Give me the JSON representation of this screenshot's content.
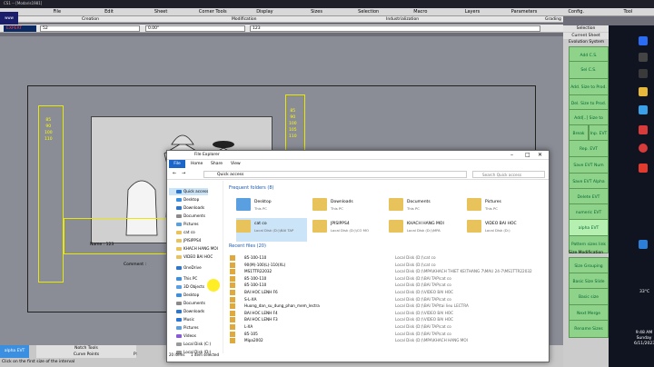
{
  "app": {
    "title": "CS1 -- [Modaris1981]",
    "logo": "www",
    "expert": "EXPERT"
  },
  "menu": [
    "File",
    "Edit",
    "Sheet",
    "Corner Tools",
    "Display",
    "Sizes",
    "Selection",
    "Macro",
    "Layers",
    "Parameters",
    "Config.",
    "Tool"
  ],
  "header": {
    "creation": "Creation",
    "modification": "Modification",
    "industrialization": "Industrialization",
    "grading": "Grading",
    "sel_label": "Selection",
    "current_sheet": "Current Sheet",
    "field1": "52",
    "field2": "0.00\"",
    "field3": "123"
  },
  "panel": {
    "items": [
      "Evolution System",
      "Add C.S.",
      "Sel C.S.",
      "Add. Size to Prod.",
      "Del. Size to Prod.",
      "Add[..] Size to Prod.",
      "Break",
      "Inp. EVT",
      "Rep. EVT",
      "Save EVT Num",
      "Save EVT Alpha",
      "Delete EVT",
      "numeric EVT",
      "alpha EVT",
      "Pattern sizes link",
      "Size Modification",
      "Size Grouping",
      "Basic Size Slide",
      "Basic size Modification",
      "Next Merge",
      "Rename Sizes"
    ]
  },
  "canvas": {
    "sizes_left": [
      "85",
      "90",
      "100",
      "110"
    ],
    "sizes_right": [
      "85",
      "90",
      "100",
      "105",
      "110"
    ],
    "name_label": "Name : 123",
    "comment": "Comment :",
    "aci": "ACI"
  },
  "status": {
    "alpha": "alpha EVT",
    "notch": "Notch Tools",
    "curve": "Curve Points",
    "hint": "Click on the first size of the interval",
    "p": "P:"
  },
  "explorer": {
    "title": "File Explorer",
    "tabs": [
      "File",
      "Home",
      "Share",
      "View"
    ],
    "path": "Quick access",
    "search": "Search Quick access",
    "nav": [
      "Quick access",
      "Desktop",
      "Downloads",
      "Documents",
      "Pictures",
      "cat co",
      "JPISIPPS4",
      "KHACH HANG MOI",
      "VIDEO BAI HOC",
      "OneDrive",
      "This PC",
      "3D Objects",
      "Desktop",
      "Documents",
      "Downloads",
      "Music",
      "Pictures",
      "Videos",
      "Local Disk (C:)",
      "Local Disk (D:)"
    ],
    "frequent_head": "Frequent folders (8)",
    "folders": [
      {
        "n": "Desktop",
        "s": "This PC"
      },
      {
        "n": "Downloads",
        "s": "This PC"
      },
      {
        "n": "Documents",
        "s": "This PC"
      },
      {
        "n": "Pictures",
        "s": "This PC"
      },
      {
        "n": "cat co",
        "s": "Local Disk (D:)\\BAI TAP"
      },
      {
        "n": "JPISIPPS4",
        "s": "Local Disk (D:)\\CO MO"
      },
      {
        "n": "KHACH HANG MOI",
        "s": "Local Disk (D:)\\MPA"
      },
      {
        "n": "VIDEO BAI HOC",
        "s": "Local Disk (D:)"
      }
    ],
    "recent_head": "Recent files (20)",
    "recent": [
      {
        "n": "85-100-110",
        "p": "Local Disk (D:)\\cat co"
      },
      {
        "n": "90(M)-100(L)-110(XL)",
        "p": "Local Disk (D:)\\cat co"
      },
      {
        "n": "MS1TTR22032",
        "p": "Local Disk (D:)\\MPA\\KHACH THIET KE\\THANG 7\\MAU 24-7\\MS1TTR22032"
      },
      {
        "n": "85-100-110",
        "p": "Local Disk (D:)\\BAI TAP\\cat co"
      },
      {
        "n": "85-100-110",
        "p": "Local Disk (D:)\\BAI TAP\\cat co"
      },
      {
        "n": "BAI HOC LENH F6",
        "p": "Local Disk (D:)\\VIDEO BAI HOC"
      },
      {
        "n": "S-L-XA",
        "p": "Local Disk (D:)\\BAI TAP\\cat co"
      },
      {
        "n": "Huong_dan_su_dung_phan_mem_lectra",
        "p": "Local Disk (D:)\\BAI TAP\\tai lieu LECTRA"
      },
      {
        "n": "BAI HOC LENH F4",
        "p": "Local Disk (D:)\\VIDEO BAI HOC"
      },
      {
        "n": "BAI HOC LENH F3",
        "p": "Local Disk (D:)\\VIDEO BAI HOC"
      },
      {
        "n": "L-XA",
        "p": "Local Disk (D:)\\BAI TAP\\cat co"
      },
      {
        "n": "85-105",
        "p": "Local Disk (D:)\\BAI TAP\\cat co"
      },
      {
        "n": "Mipa2002",
        "p": "Local Disk (D:)\\MPA\\KHACH HANG MOI"
      }
    ],
    "status": {
      "count": "20 items",
      "sel": "1 item selected"
    }
  },
  "tray": {
    "temp": "33°C",
    "time": "9:48 AM",
    "day": "Sunday",
    "date": "6/11/2023"
  }
}
